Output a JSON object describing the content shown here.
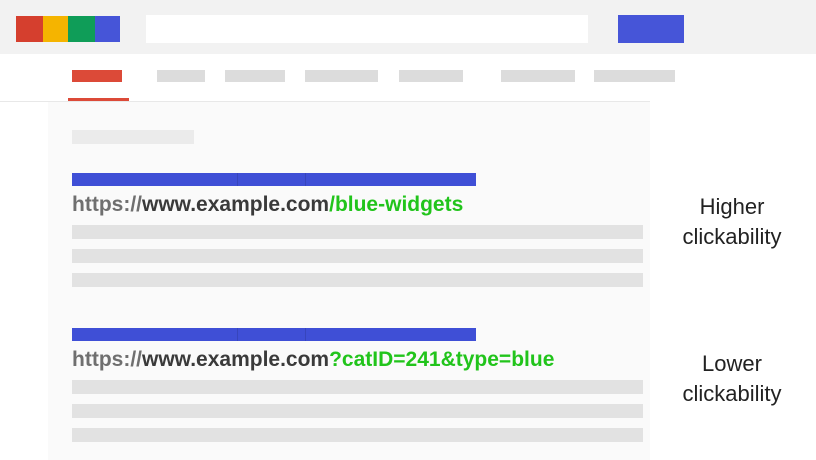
{
  "colors": {
    "header_bg": "#f2f2f2",
    "logo": [
      "#d53f2e",
      "#f5b400",
      "#0f9d58",
      "#4655d8"
    ],
    "search_button": "#4655d8",
    "active_tab": "#dc4a38",
    "result_title": "#3f4fd6",
    "url_path_green": "#21c41b",
    "url_domain": "#3a3a3a",
    "url_scheme": "#6f6f6f"
  },
  "logo": {
    "blocks": [
      {
        "name": "red-block",
        "color": "#d53f2e"
      },
      {
        "name": "yellow-block",
        "color": "#f5b400"
      },
      {
        "name": "green-block",
        "color": "#0f9d58"
      },
      {
        "name": "blue-block",
        "color": "#4655d8"
      }
    ]
  },
  "results": [
    {
      "url_scheme": "https://",
      "url_domain": "www.example.com",
      "url_path": "/blue-widgets",
      "annotation": [
        "Higher",
        "clickability"
      ]
    },
    {
      "url_scheme": "https://",
      "url_domain": "www.example.com",
      "url_path": "?catID=241&type=blue",
      "annotation": [
        "Lower",
        "clickability"
      ]
    }
  ]
}
